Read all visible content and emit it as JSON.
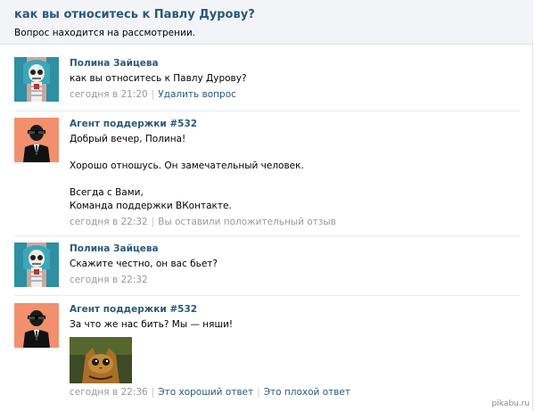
{
  "question": {
    "title": "как вы относитесь к Павлу Дурову?",
    "status": "Вопрос находится на расcмотрении."
  },
  "messages": [
    {
      "author": "Полина Зайцева",
      "lines": [
        "как вы относитесь к Павлу Дурову?"
      ],
      "time": "сегодня в 21:20",
      "actions": [
        "Удалить вопрос"
      ]
    },
    {
      "author": "Агент поддержки #532",
      "lines": [
        "Добрый вечер, Полина!",
        "",
        "Хорошо отношусь. Он замечательный человек.",
        "",
        "Всегда с Вами,",
        "Команда поддержки ВКонтакте."
      ],
      "time": "сегодня в 22:32",
      "actions": [
        "Вы оставили положительный отзыв"
      ]
    },
    {
      "author": "Полина Зайцева",
      "lines": [
        "Скажите честно, он вас бьет?"
      ],
      "time": "сегодня в 22:32",
      "actions": []
    },
    {
      "author": "Агент поддержки #532",
      "lines": [
        "За что же нас бить? Мы — няши!"
      ],
      "time": "сегодня в 22:36",
      "actions": [
        "Это хороший ответ",
        "Это плохой ответ"
      ]
    }
  ],
  "watermark": "pikabu.ru",
  "colors": {
    "link": "#2b587a",
    "agent_avatar_bg": "#f2906d",
    "header_bg": "#f2f4f7"
  }
}
